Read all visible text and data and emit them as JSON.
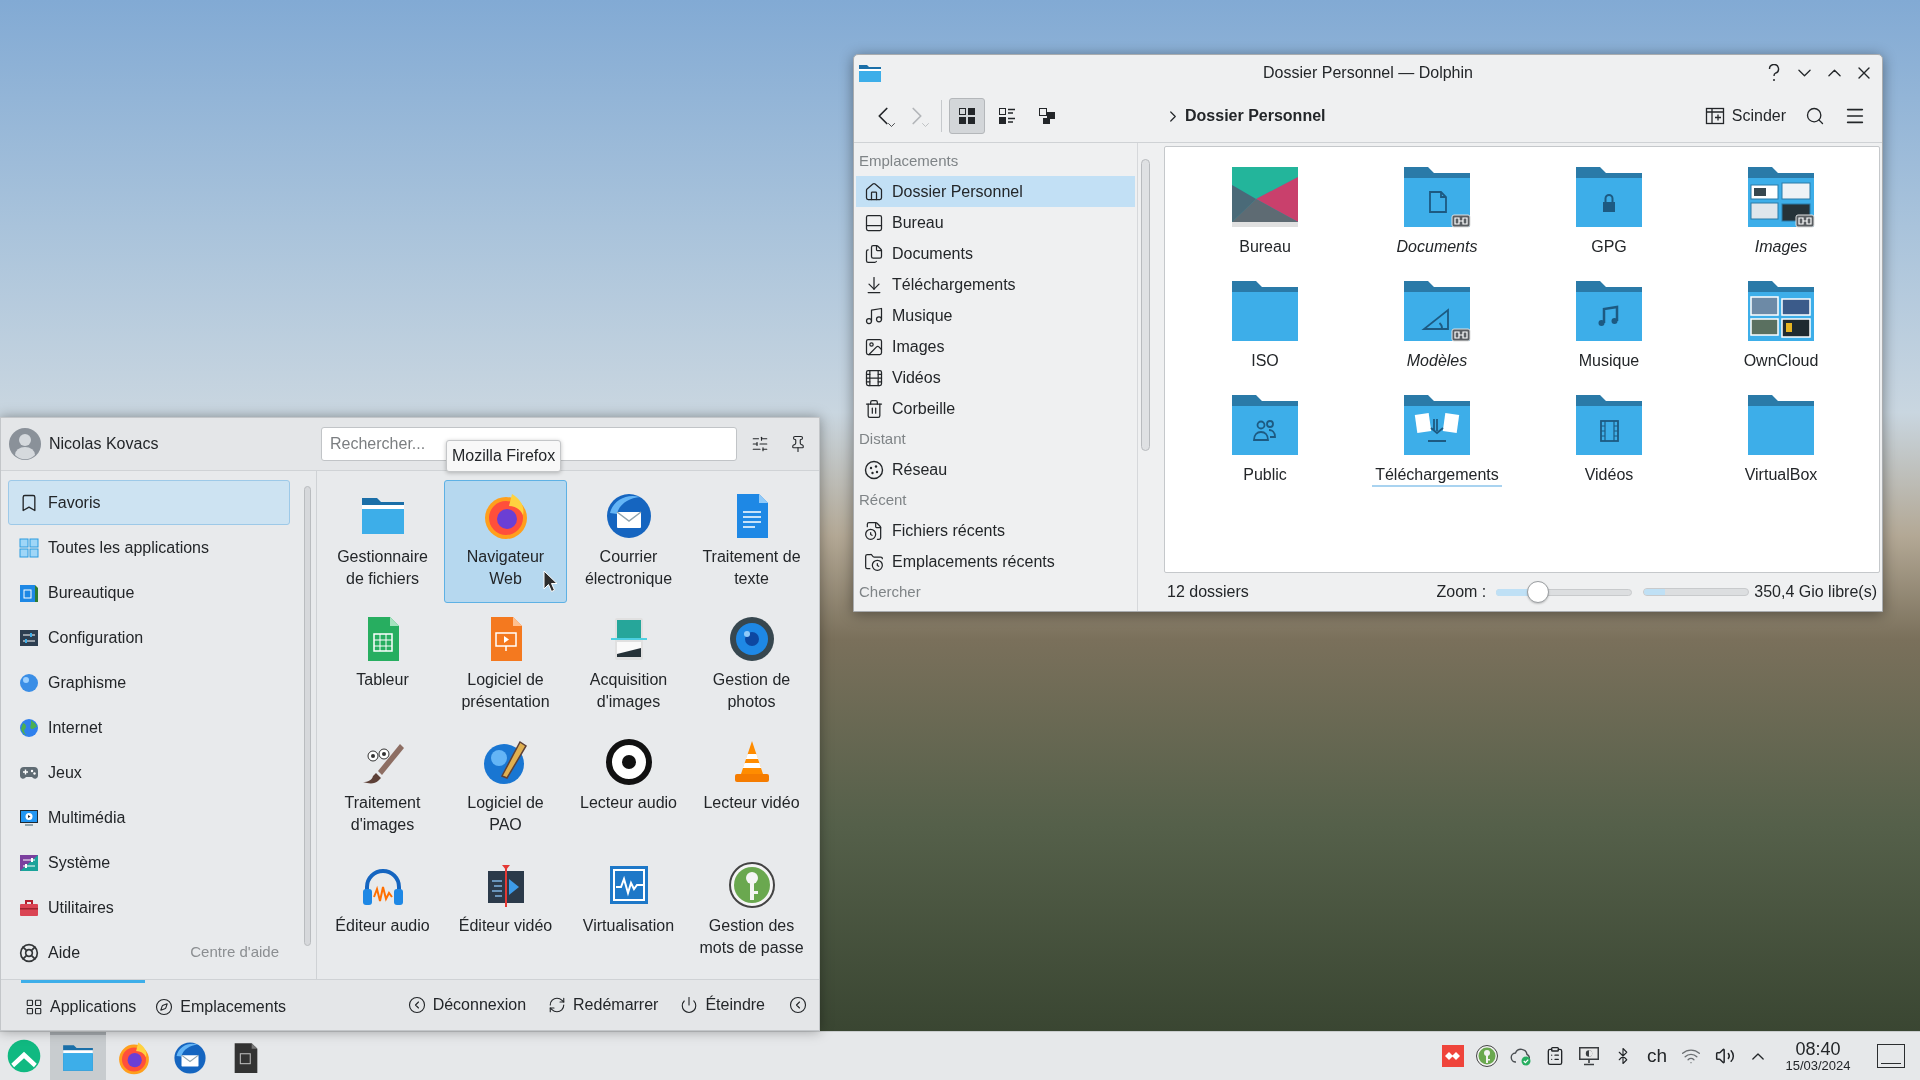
{
  "launcher": {
    "user": {
      "name": "Nicolas Kovacs"
    },
    "search": {
      "placeholder": "Rechercher..."
    },
    "tooltip": "Mozilla Firefox",
    "categories": [
      {
        "label": "Favoris",
        "kind": "favorites",
        "selected": true
      },
      {
        "label": "Toutes les applications",
        "kind": "all",
        "selected": false
      },
      {
        "label": "Bureautique",
        "kind": "office",
        "selected": false
      },
      {
        "label": "Configuration",
        "kind": "settings",
        "selected": false
      },
      {
        "label": "Graphisme",
        "kind": "graphics",
        "selected": false
      },
      {
        "label": "Internet",
        "kind": "internet",
        "selected": false
      },
      {
        "label": "Jeux",
        "kind": "games",
        "selected": false
      },
      {
        "label": "Multimédia",
        "kind": "multimedia",
        "selected": false
      },
      {
        "label": "Système",
        "kind": "system",
        "selected": false
      },
      {
        "label": "Utilitaires",
        "kind": "utilities",
        "selected": false
      },
      {
        "label": "Aide",
        "description": "Centre d'aide",
        "kind": "help",
        "selected": false
      }
    ],
    "apps": [
      {
        "label": "Gestionnaire de fichiers",
        "kind": "files",
        "selected": false
      },
      {
        "label": "Navigateur Web",
        "kind": "browser",
        "selected": true
      },
      {
        "label": "Courrier électronique",
        "kind": "mail",
        "selected": false
      },
      {
        "label": "Traitement de texte",
        "kind": "writer",
        "selected": false
      },
      {
        "label": "Tableur",
        "kind": "spreadsheet",
        "selected": false
      },
      {
        "label": "Logiciel de présentation",
        "kind": "presentation",
        "selected": false
      },
      {
        "label": "Acquisition d'images",
        "kind": "scanner",
        "selected": false
      },
      {
        "label": "Gestion de photos",
        "kind": "photos",
        "selected": false
      },
      {
        "label": "Traitement d'images",
        "kind": "painting",
        "selected": false
      },
      {
        "label": "Logiciel de PAO",
        "kind": "publishing",
        "selected": false
      },
      {
        "label": "Lecteur audio",
        "kind": "audio-player",
        "selected": false
      },
      {
        "label": "Lecteur vidéo",
        "kind": "video-player",
        "selected": false
      },
      {
        "label": "Éditeur audio",
        "kind": "audio-editor",
        "selected": false
      },
      {
        "label": "Éditeur vidéo",
        "kind": "video-editor",
        "selected": false
      },
      {
        "label": "Virtualisation",
        "kind": "virtualization",
        "selected": false
      },
      {
        "label": "Gestion des mots de passe",
        "kind": "passwords",
        "selected": false
      }
    ],
    "tabs": [
      {
        "label": "Applications",
        "kind": "applications",
        "selected": true
      },
      {
        "label": "Emplacements",
        "kind": "places",
        "selected": false
      }
    ],
    "actions": [
      {
        "label": "Déconnexion",
        "kind": "logout"
      },
      {
        "label": "Redémarrer",
        "kind": "restart"
      },
      {
        "label": "Éteindre",
        "kind": "shutdown"
      }
    ]
  },
  "dolphin": {
    "window": {
      "title": "Dossier Personnel — Dolphin"
    },
    "navigation": [
      {
        "kind": "back",
        "disabled": false
      },
      {
        "kind": "forward",
        "disabled": true
      }
    ],
    "view_modes": [
      {
        "kind": "icons",
        "selected": true
      },
      {
        "kind": "compact",
        "selected": false
      },
      {
        "kind": "details",
        "selected": false
      }
    ],
    "breadcrumb": "Dossier Personnel",
    "split_button": "Scinder",
    "places": [
      {
        "heading": "Emplacements",
        "items": [
          {
            "label": "Dossier Personnel",
            "kind": "home",
            "selected": true
          },
          {
            "label": "Bureau",
            "kind": "desktop",
            "selected": false
          },
          {
            "label": "Documents",
            "kind": "documents",
            "selected": false
          },
          {
            "label": "Téléchargements",
            "kind": "downloads",
            "selected": false
          },
          {
            "label": "Musique",
            "kind": "music",
            "selected": false
          },
          {
            "label": "Images",
            "kind": "pictures",
            "selected": false
          },
          {
            "label": "Vidéos",
            "kind": "videos",
            "selected": false
          },
          {
            "label": "Corbeille",
            "kind": "trash",
            "selected": false
          }
        ]
      },
      {
        "heading": "Distant",
        "items": [
          {
            "label": "Réseau",
            "kind": "network",
            "selected": false
          }
        ]
      },
      {
        "heading": "Récent",
        "items": [
          {
            "label": "Fichiers récents",
            "kind": "recent-files",
            "selected": false
          },
          {
            "label": "Emplacements récents",
            "kind": "recent-locations",
            "selected": false
          }
        ]
      },
      {
        "heading": "Chercher"
      }
    ],
    "folders": [
      {
        "name": "Bureau",
        "kind": "desktop",
        "symlink": false,
        "hovered": false
      },
      {
        "name": "Documents",
        "kind": "documents",
        "symlink": true,
        "hovered": false
      },
      {
        "name": "GPG",
        "kind": "locked",
        "symlink": false,
        "hovered": false
      },
      {
        "name": "Images",
        "kind": "pictures",
        "symlink": true,
        "hovered": false
      },
      {
        "name": "ISO",
        "kind": "plain",
        "symlink": false,
        "hovered": false
      },
      {
        "name": "Modèles",
        "kind": "templates",
        "symlink": true,
        "hovered": false
      },
      {
        "name": "Musique",
        "kind": "music",
        "symlink": false,
        "hovered": false
      },
      {
        "name": "OwnCloud",
        "kind": "photos",
        "symlink": false,
        "hovered": false
      },
      {
        "name": "Public",
        "kind": "public",
        "symlink": false,
        "hovered": false
      },
      {
        "name": "Téléchargements",
        "kind": "downloads",
        "symlink": false,
        "hovered": true
      },
      {
        "name": "Vidéos",
        "kind": "videos",
        "symlink": false,
        "hovered": false
      },
      {
        "name": "VirtualBox",
        "kind": "plain",
        "symlink": false,
        "hovered": false
      }
    ],
    "status_bar": {
      "summary": "12 dossiers",
      "zoom_label": "Zoom :",
      "zoom": {
        "level": 0.27
      },
      "disk": {
        "level": 0.2
      },
      "free_space": "350,4 Gio libre(s)"
    }
  },
  "taskbar": {
    "tasks": [
      {
        "kind": "files",
        "active": true
      },
      {
        "kind": "browser",
        "active": false
      },
      {
        "kind": "mail",
        "active": false
      },
      {
        "kind": "notes",
        "active": false
      }
    ],
    "keyboard_layout": "ch",
    "clock": {
      "time": "08:40",
      "date": "15/03/2024"
    }
  }
}
